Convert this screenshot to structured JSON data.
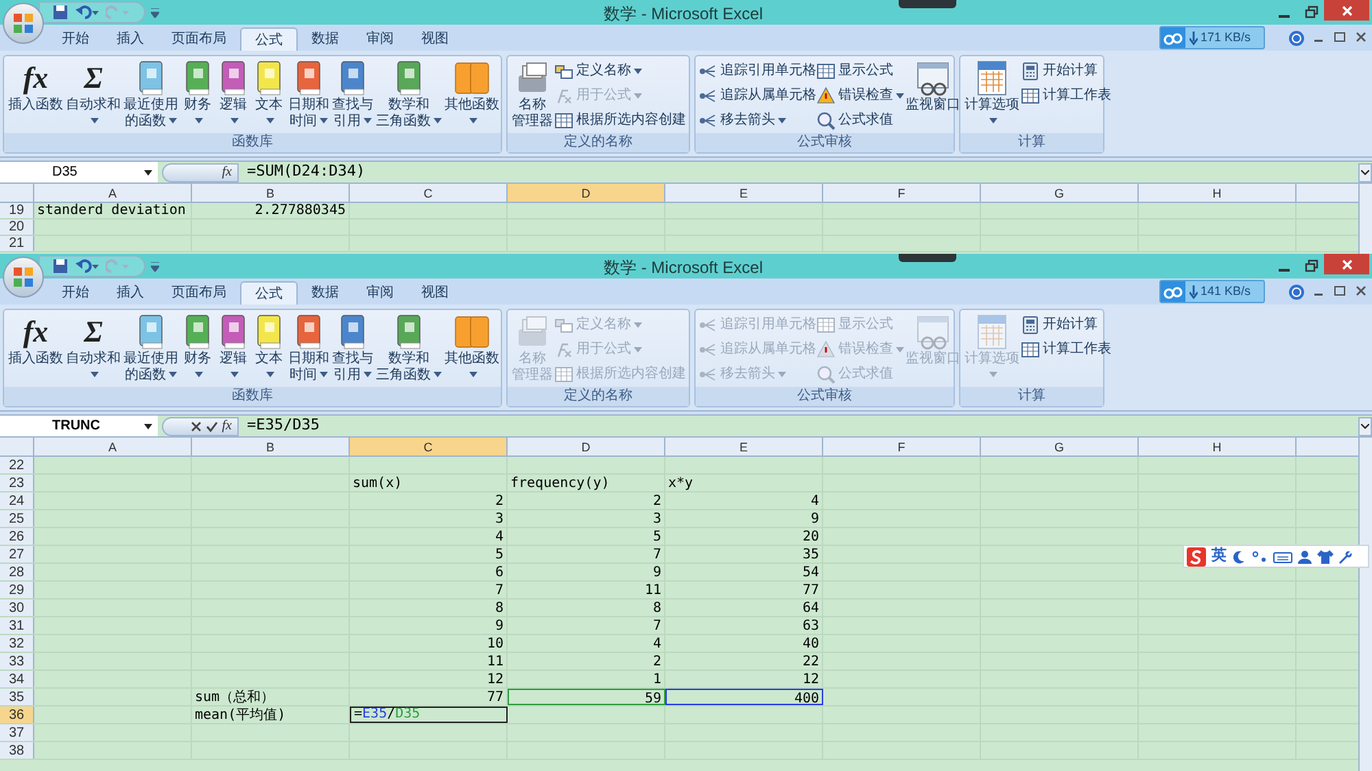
{
  "windows": [
    {
      "title": "数学 - Microsoft Excel",
      "tabs": [
        {
          "label": "开始",
          "selected": false
        },
        {
          "label": "插入",
          "selected": false
        },
        {
          "label": "页面布局",
          "selected": false
        },
        {
          "label": "公式",
          "selected": true
        },
        {
          "label": "数据",
          "selected": false
        },
        {
          "label": "审阅",
          "selected": false
        },
        {
          "label": "视图",
          "selected": false
        }
      ],
      "network_speed": "171 KB/s",
      "ribbon": [
        {
          "label": "函数库",
          "items": [
            {
              "kind": "large",
              "glyph": "fx",
              "lines": [
                "插入函数"
              ],
              "dropdown": false,
              "disabled": false
            },
            {
              "kind": "separator"
            },
            {
              "kind": "large",
              "glyph": "Σ",
              "lines": [
                "自动求和"
              ],
              "dropdown": true,
              "disabled": false
            },
            {
              "kind": "large",
              "lines": [
                "最近使用",
                "的函数"
              ],
              "dropdown": true,
              "disabled": false
            },
            {
              "kind": "large",
              "lines": [
                "财务"
              ],
              "dropdown": true,
              "disabled": false
            },
            {
              "kind": "large",
              "lines": [
                "逻辑"
              ],
              "dropdown": true,
              "disabled": false
            },
            {
              "kind": "large",
              "lines": [
                "文本"
              ],
              "dropdown": true,
              "disabled": false
            },
            {
              "kind": "large",
              "lines": [
                "日期和",
                "时间"
              ],
              "dropdown": true,
              "disabled": false
            },
            {
              "kind": "large",
              "lines": [
                "查找与",
                "引用"
              ],
              "dropdown": true,
              "disabled": false
            },
            {
              "kind": "large",
              "lines": [
                "数学和",
                "三角函数"
              ],
              "dropdown": true,
              "disabled": false
            },
            {
              "kind": "large",
              "lines": [
                "其他函数"
              ],
              "dropdown": true,
              "disabled": false
            }
          ]
        },
        {
          "label": "定义的名称",
          "items": [
            {
              "kind": "large",
              "lines": [
                "名称",
                "管理器"
              ],
              "dropdown": false,
              "disabled": false
            },
            {
              "kind": "stack",
              "items": [
                {
                  "label": "定义名称",
                  "dropdown": true,
                  "disabled": false
                },
                {
                  "label": "用于公式",
                  "dropdown": true,
                  "disabled": true
                },
                {
                  "label": "根据所选内容创建",
                  "dropdown": false,
                  "disabled": false
                }
              ]
            }
          ]
        },
        {
          "label": "公式审核",
          "items": [
            {
              "kind": "stack",
              "items": [
                {
                  "label": "追踪引用单元格",
                  "dropdown": false,
                  "disabled": false
                },
                {
                  "label": "追踪从属单元格",
                  "dropdown": false,
                  "disabled": false
                },
                {
                  "label": "移去箭头",
                  "dropdown": true,
                  "disabled": false
                }
              ]
            },
            {
              "kind": "stack",
              "items": [
                {
                  "label": "显示公式",
                  "dropdown": false,
                  "disabled": false
                },
                {
                  "label": "错误检查",
                  "dropdown": true,
                  "disabled": false
                },
                {
                  "label": "公式求值",
                  "dropdown": false,
                  "disabled": false
                }
              ]
            },
            {
              "kind": "separator"
            },
            {
              "kind": "large",
              "lines": [
                "监视窗口"
              ],
              "dropdown": false,
              "disabled": false
            }
          ]
        },
        {
          "label": "计算",
          "items": [
            {
              "kind": "large",
              "lines": [
                "计算选项"
              ],
              "dropdown": true,
              "disabled": false
            },
            {
              "kind": "stack",
              "items": [
                {
                  "label": "开始计算",
                  "dropdown": false,
                  "disabled": false
                },
                {
                  "label": "计算工作表",
                  "dropdown": false,
                  "disabled": false
                }
              ]
            }
          ]
        }
      ],
      "formula_bar": {
        "name_box": "D35",
        "fx": "fx",
        "formula": "=SUM(D24:D34)",
        "editing": false
      },
      "columns": [
        {
          "label": "A",
          "selected": false
        },
        {
          "label": "B",
          "selected": false
        },
        {
          "label": "C",
          "selected": false
        },
        {
          "label": "D",
          "selected": true
        },
        {
          "label": "E",
          "selected": false
        },
        {
          "label": "F",
          "selected": false
        },
        {
          "label": "G",
          "selected": false
        },
        {
          "label": "H",
          "selected": false
        }
      ],
      "rows": [
        {
          "number": "19",
          "selected": false,
          "cells": {
            "A": {
              "kind": "text",
              "text": "standerd deviation"
            },
            "B": {
              "kind": "number",
              "text": "2.277880345"
            }
          }
        },
        {
          "number": "20",
          "selected": false,
          "cells": {}
        },
        {
          "number": "21",
          "selected": false,
          "cells": {}
        }
      ]
    },
    {
      "title": "数学 - Microsoft Excel",
      "tabs": [
        {
          "label": "开始",
          "selected": false
        },
        {
          "label": "插入",
          "selected": false
        },
        {
          "label": "页面布局",
          "selected": false
        },
        {
          "label": "公式",
          "selected": true
        },
        {
          "label": "数据",
          "selected": false
        },
        {
          "label": "审阅",
          "selected": false
        },
        {
          "label": "视图",
          "selected": false
        }
      ],
      "network_speed": "141 KB/s",
      "ribbon": [
        {
          "label": "函数库",
          "items": [
            {
              "kind": "large",
              "glyph": "fx",
              "lines": [
                "插入函数"
              ],
              "dropdown": false,
              "disabled": false
            },
            {
              "kind": "separator"
            },
            {
              "kind": "large",
              "glyph": "Σ",
              "lines": [
                "自动求和"
              ],
              "dropdown": true,
              "disabled": false
            },
            {
              "kind": "large",
              "lines": [
                "最近使用",
                "的函数"
              ],
              "dropdown": true,
              "disabled": false
            },
            {
              "kind": "large",
              "lines": [
                "财务"
              ],
              "dropdown": true,
              "disabled": false
            },
            {
              "kind": "large",
              "lines": [
                "逻辑"
              ],
              "dropdown": true,
              "disabled": false
            },
            {
              "kind": "large",
              "lines": [
                "文本"
              ],
              "dropdown": true,
              "disabled": false
            },
            {
              "kind": "large",
              "lines": [
                "日期和",
                "时间"
              ],
              "dropdown": true,
              "disabled": false
            },
            {
              "kind": "large",
              "lines": [
                "查找与",
                "引用"
              ],
              "dropdown": true,
              "disabled": false
            },
            {
              "kind": "large",
              "lines": [
                "数学和",
                "三角函数"
              ],
              "dropdown": true,
              "disabled": false
            },
            {
              "kind": "large",
              "lines": [
                "其他函数"
              ],
              "dropdown": true,
              "disabled": false
            }
          ]
        },
        {
          "label": "定义的名称",
          "items": [
            {
              "kind": "large",
              "lines": [
                "名称",
                "管理器"
              ],
              "dropdown": false,
              "disabled": true
            },
            {
              "kind": "stack",
              "items": [
                {
                  "label": "定义名称",
                  "dropdown": true,
                  "disabled": true
                },
                {
                  "label": "用于公式",
                  "dropdown": true,
                  "disabled": true
                },
                {
                  "label": "根据所选内容创建",
                  "dropdown": false,
                  "disabled": true
                }
              ]
            }
          ]
        },
        {
          "label": "公式审核",
          "items": [
            {
              "kind": "stack",
              "items": [
                {
                  "label": "追踪引用单元格",
                  "dropdown": false,
                  "disabled": true
                },
                {
                  "label": "追踪从属单元格",
                  "dropdown": false,
                  "disabled": true
                },
                {
                  "label": "移去箭头",
                  "dropdown": true,
                  "disabled": true
                }
              ]
            },
            {
              "kind": "stack",
              "items": [
                {
                  "label": "显示公式",
                  "dropdown": false,
                  "disabled": true
                },
                {
                  "label": "错误检查",
                  "dropdown": true,
                  "disabled": true
                },
                {
                  "label": "公式求值",
                  "dropdown": false,
                  "disabled": true
                }
              ]
            },
            {
              "kind": "separator"
            },
            {
              "kind": "large",
              "lines": [
                "监视窗口"
              ],
              "dropdown": false,
              "disabled": true
            }
          ]
        },
        {
          "label": "计算",
          "items": [
            {
              "kind": "large",
              "lines": [
                "计算选项"
              ],
              "dropdown": true,
              "disabled": true
            },
            {
              "kind": "stack",
              "items": [
                {
                  "label": "开始计算",
                  "dropdown": false,
                  "disabled": false
                },
                {
                  "label": "计算工作表",
                  "dropdown": false,
                  "disabled": false
                }
              ]
            }
          ]
        }
      ],
      "formula_bar": {
        "name_box": "TRUNC",
        "fx": "fx",
        "formula": "=E35/D35",
        "editing": true
      },
      "columns": [
        {
          "label": "A",
          "selected": false
        },
        {
          "label": "B",
          "selected": false
        },
        {
          "label": "C",
          "selected": true
        },
        {
          "label": "D",
          "selected": false
        },
        {
          "label": "E",
          "selected": false
        },
        {
          "label": "F",
          "selected": false
        },
        {
          "label": "G",
          "selected": false
        },
        {
          "label": "H",
          "selected": false
        }
      ],
      "rows": [
        {
          "number": "22",
          "selected": false,
          "cells": {}
        },
        {
          "number": "23",
          "selected": false,
          "cells": {
            "C": {
              "kind": "text",
              "text": "sum(x)"
            },
            "D": {
              "kind": "text",
              "text": "frequency(y)"
            },
            "E": {
              "kind": "text",
              "text": "x*y"
            }
          }
        },
        {
          "number": "24",
          "selected": false,
          "cells": {
            "C": {
              "kind": "number",
              "text": "2"
            },
            "D": {
              "kind": "number",
              "text": "2"
            },
            "E": {
              "kind": "number",
              "text": "4"
            }
          }
        },
        {
          "number": "25",
          "selected": false,
          "cells": {
            "C": {
              "kind": "number",
              "text": "3"
            },
            "D": {
              "kind": "number",
              "text": "3"
            },
            "E": {
              "kind": "number",
              "text": "9"
            }
          }
        },
        {
          "number": "26",
          "selected": false,
          "cells": {
            "C": {
              "kind": "number",
              "text": "4"
            },
            "D": {
              "kind": "number",
              "text": "5"
            },
            "E": {
              "kind": "number",
              "text": "20"
            }
          }
        },
        {
          "number": "27",
          "selected": false,
          "cells": {
            "C": {
              "kind": "number",
              "text": "5"
            },
            "D": {
              "kind": "number",
              "text": "7"
            },
            "E": {
              "kind": "number",
              "text": "35"
            }
          }
        },
        {
          "number": "28",
          "selected": false,
          "cells": {
            "C": {
              "kind": "number",
              "text": "6"
            },
            "D": {
              "kind": "number",
              "text": "9"
            },
            "E": {
              "kind": "number",
              "text": "54"
            }
          }
        },
        {
          "number": "29",
          "selected": false,
          "cells": {
            "C": {
              "kind": "number",
              "text": "7"
            },
            "D": {
              "kind": "number",
              "text": "11"
            },
            "E": {
              "kind": "number",
              "text": "77"
            }
          }
        },
        {
          "number": "30",
          "selected": false,
          "cells": {
            "C": {
              "kind": "number",
              "text": "8"
            },
            "D": {
              "kind": "number",
              "text": "8"
            },
            "E": {
              "kind": "number",
              "text": "64"
            }
          }
        },
        {
          "number": "31",
          "selected": false,
          "cells": {
            "C": {
              "kind": "number",
              "text": "9"
            },
            "D": {
              "kind": "number",
              "text": "7"
            },
            "E": {
              "kind": "number",
              "text": "63"
            }
          }
        },
        {
          "number": "32",
          "selected": false,
          "cells": {
            "C": {
              "kind": "number",
              "text": "10"
            },
            "D": {
              "kind": "number",
              "text": "4"
            },
            "E": {
              "kind": "number",
              "text": "40"
            }
          }
        },
        {
          "number": "33",
          "selected": false,
          "cells": {
            "C": {
              "kind": "number",
              "text": "11"
            },
            "D": {
              "kind": "number",
              "text": "2"
            },
            "E": {
              "kind": "number",
              "text": "22"
            }
          }
        },
        {
          "number": "34",
          "selected": false,
          "cells": {
            "C": {
              "kind": "number",
              "text": "12"
            },
            "D": {
              "kind": "number",
              "text": "1"
            },
            "E": {
              "kind": "number",
              "text": "12"
            }
          }
        },
        {
          "number": "35",
          "selected": false,
          "cells": {
            "B": {
              "kind": "text",
              "text": "sum（总和）"
            },
            "C": {
              "kind": "number",
              "text": "77"
            },
            "D": {
              "kind": "number",
              "text": "59",
              "color": "#2e9e3e"
            },
            "E": {
              "kind": "number",
              "text": "400",
              "color": "#2a3ee0"
            }
          }
        },
        {
          "number": "36",
          "selected": true,
          "cells": {
            "B": {
              "kind": "text",
              "text": "mean(平均值)"
            },
            "C": {
              "kind": "formula",
              "parts": [
                {
                  "text": "="
                },
                {
                  "text": "E35",
                  "color": "#2a3ee0"
                },
                {
                  "text": "/"
                },
                {
                  "text": "D35",
                  "color": "#2e9e3e"
                }
              ]
            }
          }
        },
        {
          "number": "37",
          "selected": false,
          "cells": {}
        },
        {
          "number": "38",
          "selected": false,
          "cells": {}
        }
      ]
    }
  ],
  "ime_toolbar": {
    "mode": "英"
  }
}
